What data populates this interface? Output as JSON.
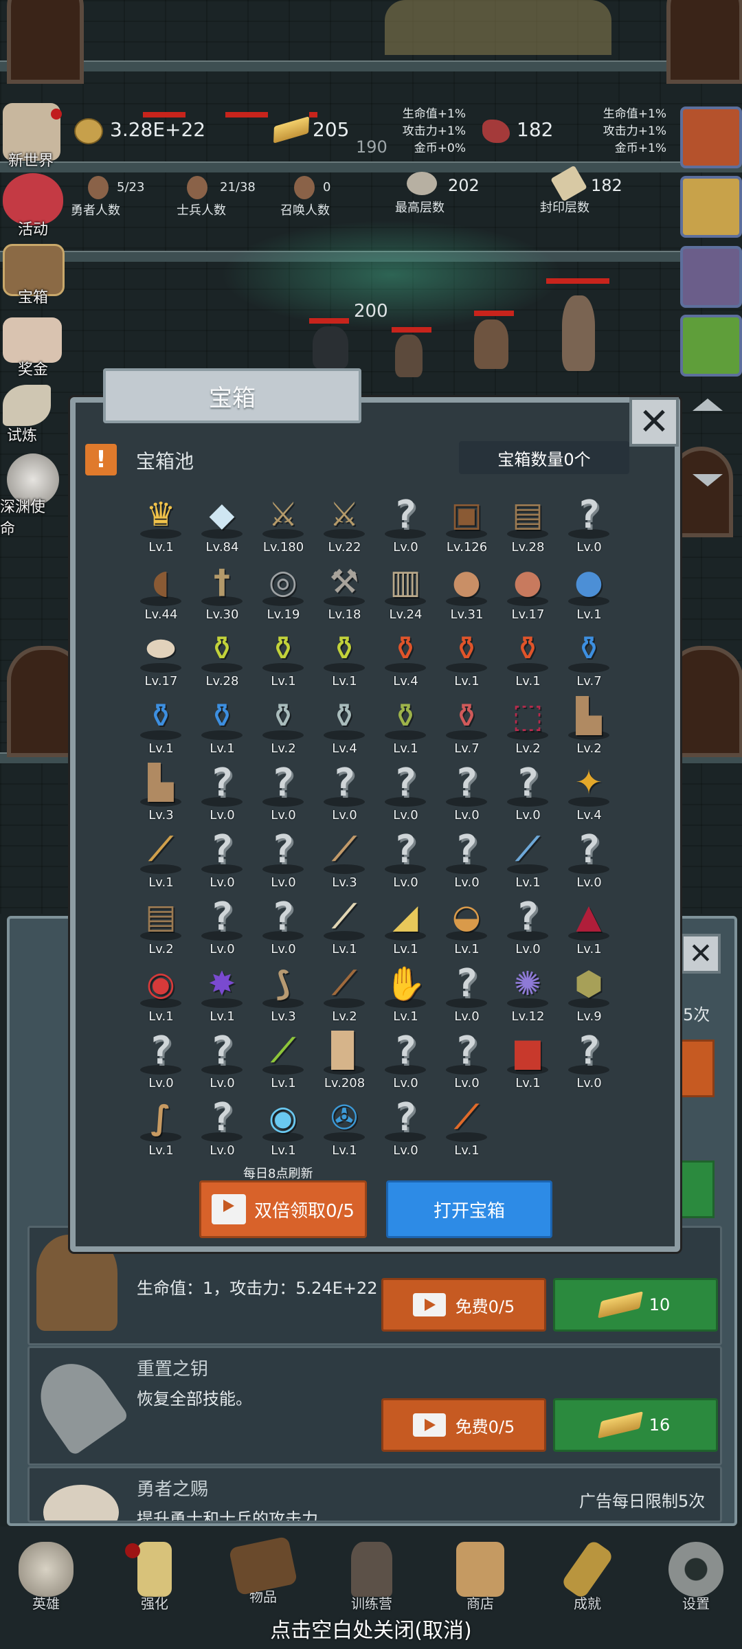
{
  "resources": {
    "gold": "3.28E+22",
    "bars": "205",
    "gems": "182",
    "heroes": "5/23",
    "heroes_label": "勇者人数",
    "soldiers": "21/38",
    "soldiers_label": "士兵人数",
    "summons": "0",
    "summons_label": "召唤人数",
    "highest_floor": "202",
    "highest_floor_label": "最高层数",
    "sealed_floor": "182",
    "sealed_floor_label": "封印层数"
  },
  "bonus_left": [
    "生命值+1%",
    "攻击力+1%",
    "金币+0%"
  ],
  "bonus_right": [
    "生命值+1%",
    "攻击力+1%",
    "金币+1%"
  ],
  "scene": {
    "damage_text": "200",
    "damage_text_2": "190"
  },
  "side_menu": [
    "新世界",
    "活动",
    "宝箱",
    "奖金",
    "试炼",
    "深渊使命"
  ],
  "modal": {
    "tab_title": "宝箱",
    "pool_label": "宝箱池",
    "chest_count": "宝箱数量0个",
    "refresh_note": "每日8点刷新",
    "double_button": "双倍领取0/5",
    "open_button": "打开宝箱",
    "items": [
      {
        "icon": "crown",
        "lv": "Lv.1"
      },
      {
        "icon": "diamond",
        "lv": "Lv.84"
      },
      {
        "icon": "sword",
        "lv": "Lv.180"
      },
      {
        "icon": "sword",
        "lv": "Lv.22"
      },
      {
        "icon": "unknown",
        "lv": "Lv.0"
      },
      {
        "icon": "leather-armor",
        "lv": "Lv.126"
      },
      {
        "icon": "backpack",
        "lv": "Lv.28"
      },
      {
        "icon": "unknown",
        "lv": "Lv.0"
      },
      {
        "icon": "leather-helmet",
        "lv": "Lv.44"
      },
      {
        "icon": "dagger",
        "lv": "Lv.30"
      },
      {
        "icon": "iron-helmet",
        "lv": "Lv.19"
      },
      {
        "icon": "hammer",
        "lv": "Lv.18"
      },
      {
        "icon": "great-helm",
        "lv": "Lv.24"
      },
      {
        "icon": "meat",
        "lv": "Lv.31"
      },
      {
        "icon": "steak",
        "lv": "Lv.17"
      },
      {
        "icon": "blue-sack",
        "lv": "Lv.1"
      },
      {
        "icon": "bread",
        "lv": "Lv.17"
      },
      {
        "icon": "yellow-potion",
        "lv": "Lv.28"
      },
      {
        "icon": "yellow-potion",
        "lv": "Lv.1"
      },
      {
        "icon": "yellow-potion",
        "lv": "Lv.1"
      },
      {
        "icon": "red-potion",
        "lv": "Lv.4"
      },
      {
        "icon": "red-potion",
        "lv": "Lv.1"
      },
      {
        "icon": "red-potion",
        "lv": "Lv.1"
      },
      {
        "icon": "blue-potion",
        "lv": "Lv.7"
      },
      {
        "icon": "blue-potion",
        "lv": "Lv.1"
      },
      {
        "icon": "blue-potion",
        "lv": "Lv.1"
      },
      {
        "icon": "grey-bottle",
        "lv": "Lv.2"
      },
      {
        "icon": "grey-bottle",
        "lv": "Lv.4"
      },
      {
        "icon": "green-bottle",
        "lv": "Lv.1"
      },
      {
        "icon": "red-bottle",
        "lv": "Lv.7"
      },
      {
        "icon": "winged-boot",
        "lv": "Lv.2"
      },
      {
        "icon": "boot",
        "lv": "Lv.2"
      },
      {
        "icon": "boot",
        "lv": "Lv.3"
      },
      {
        "icon": "unknown",
        "lv": "Lv.0"
      },
      {
        "icon": "unknown",
        "lv": "Lv.0"
      },
      {
        "icon": "unknown",
        "lv": "Lv.0"
      },
      {
        "icon": "unknown",
        "lv": "Lv.0"
      },
      {
        "icon": "unknown",
        "lv": "Lv.0"
      },
      {
        "icon": "unknown",
        "lv": "Lv.0"
      },
      {
        "icon": "torch",
        "lv": "Lv.4"
      },
      {
        "icon": "staff",
        "lv": "Lv.1"
      },
      {
        "icon": "unknown",
        "lv": "Lv.0"
      },
      {
        "icon": "unknown",
        "lv": "Lv.0"
      },
      {
        "icon": "wooden-staff",
        "lv": "Lv.3"
      },
      {
        "icon": "unknown",
        "lv": "Lv.0"
      },
      {
        "icon": "unknown",
        "lv": "Lv.0"
      },
      {
        "icon": "blue-wand",
        "lv": "Lv.1"
      },
      {
        "icon": "unknown",
        "lv": "Lv.0"
      },
      {
        "icon": "backpack",
        "lv": "Lv.2"
      },
      {
        "icon": "unknown",
        "lv": "Lv.0"
      },
      {
        "icon": "unknown",
        "lv": "Lv.0"
      },
      {
        "icon": "bone-club",
        "lv": "Lv.1"
      },
      {
        "icon": "cheese",
        "lv": "Lv.1"
      },
      {
        "icon": "pie",
        "lv": "Lv.1"
      },
      {
        "icon": "unknown",
        "lv": "Lv.0"
      },
      {
        "icon": "red-crystal",
        "lv": "Lv.1"
      },
      {
        "icon": "red-orb",
        "lv": "Lv.1"
      },
      {
        "icon": "cosmic-gem",
        "lv": "Lv.1"
      },
      {
        "icon": "bow",
        "lv": "Lv.3"
      },
      {
        "icon": "quiver",
        "lv": "Lv.2"
      },
      {
        "icon": "fire-gauntlet",
        "lv": "Lv.1"
      },
      {
        "icon": "unknown",
        "lv": "Lv.0"
      },
      {
        "icon": "spirit-orb",
        "lv": "Lv.12"
      },
      {
        "icon": "emblem",
        "lv": "Lv.9"
      },
      {
        "icon": "unknown",
        "lv": "Lv.0"
      },
      {
        "icon": "unknown",
        "lv": "Lv.0"
      },
      {
        "icon": "green-wand",
        "lv": "Lv.1"
      },
      {
        "icon": "beer-mug",
        "lv": "Lv.208"
      },
      {
        "icon": "unknown",
        "lv": "Lv.0"
      },
      {
        "icon": "unknown",
        "lv": "Lv.0"
      },
      {
        "icon": "red-book",
        "lv": "Lv.1"
      },
      {
        "icon": "unknown",
        "lv": "Lv.0"
      },
      {
        "icon": "whip",
        "lv": "Lv.1"
      },
      {
        "icon": "unknown",
        "lv": "Lv.0"
      },
      {
        "icon": "crystal-ball",
        "lv": "Lv.1"
      },
      {
        "icon": "compass-orb",
        "lv": "Lv.1"
      },
      {
        "icon": "unknown",
        "lv": "Lv.0"
      },
      {
        "icon": "fire-scepter",
        "lv": "Lv.1"
      }
    ]
  },
  "lower_panel": {
    "ad_limit_partial": "5次",
    "hero_desc": "生命值：1，攻击力：5.24E+22",
    "hero_free": "免费0/5",
    "hero_cost": "10",
    "key_title": "重置之钥",
    "key_desc": "恢复全部技能。",
    "key_free": "免费0/5",
    "key_cost": "16",
    "gift_title": "勇者之赐",
    "gift_desc": "提升勇士和士兵的攻击力。",
    "ad_limit": "广告每日限制5次"
  },
  "nav": [
    "英雄",
    "强化",
    "物品",
    "训练营",
    "商店",
    "成就",
    "设置"
  ],
  "footer_tip": "点击空白处关闭(取消)"
}
